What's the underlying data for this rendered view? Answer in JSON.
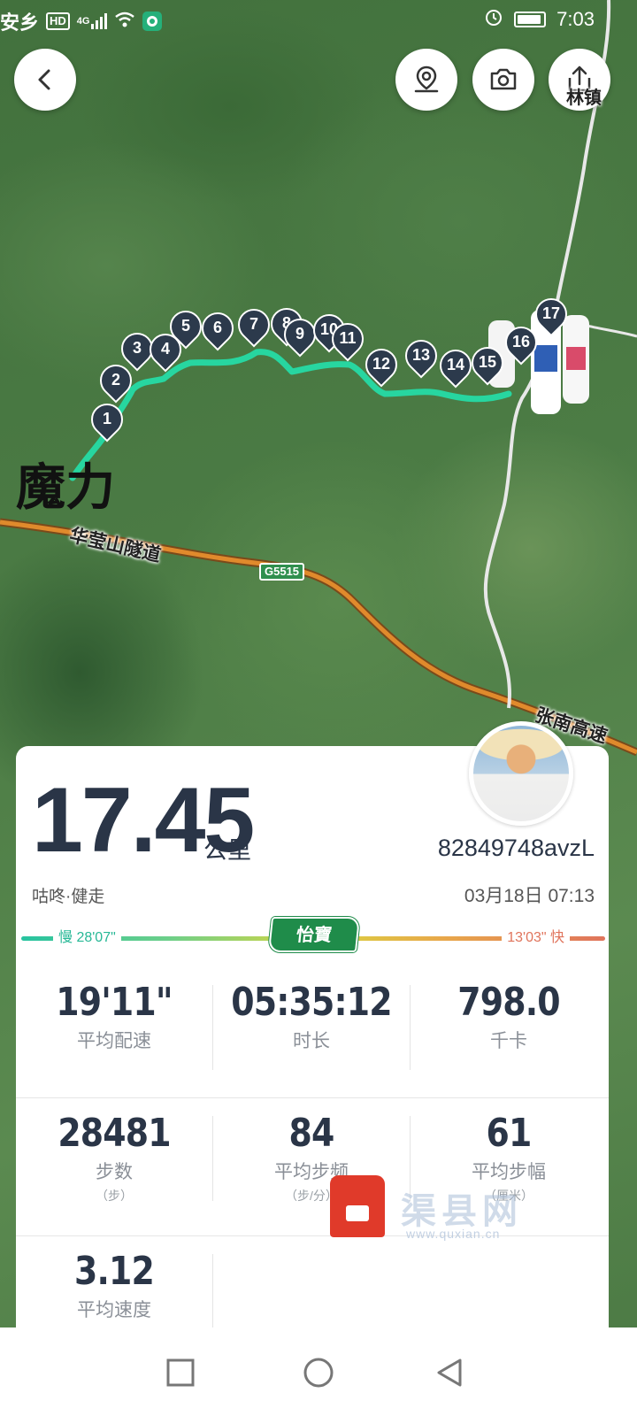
{
  "status_bar": {
    "location": "安乡",
    "network": "4G",
    "hd": "HD",
    "time": "7:03"
  },
  "map": {
    "place_label": "魔力",
    "tunnel_label": "华莹山隧道",
    "highway_code": "G5515",
    "highway_label": "张南高速",
    "corner_label": "林镇",
    "waypoints": [
      "1",
      "2",
      "3",
      "4",
      "5",
      "6",
      "7",
      "8",
      "9",
      "10",
      "11",
      "12",
      "13",
      "14",
      "15",
      "16",
      "17"
    ],
    "route_color": "#27d6a0"
  },
  "top_buttons": {
    "back": "back-icon",
    "location": "location-pin-icon",
    "camera": "camera-icon",
    "share": "share-icon"
  },
  "summary": {
    "distance": "17.45",
    "distance_unit": "公里",
    "username": "82849748avzL",
    "sport": "咕咚·健走",
    "datetime": "03月18日 07:13"
  },
  "pace": {
    "slow": "慢 28'07\"",
    "fast": "13'03\" 快",
    "sponsor": "怡寶"
  },
  "stats": {
    "avg_pace": {
      "value": "19'11\"",
      "label": "平均配速"
    },
    "duration": {
      "value": "05:35:12",
      "label": "时长"
    },
    "calories": {
      "value": "798.0",
      "label": "千卡"
    },
    "steps": {
      "value": "28481",
      "label": "步数",
      "unit": "（步）"
    },
    "cadence": {
      "value": "84",
      "label": "平均步频",
      "unit": "（步/分）"
    },
    "stride": {
      "value": "61",
      "label": "平均步幅",
      "unit": "（厘米）"
    },
    "avg_speed": {
      "value": "3.12",
      "label": "平均速度"
    }
  },
  "watermark": {
    "text": "渠县网",
    "url": "www.quxian.cn"
  },
  "colors": {
    "accent_dark": "#2a3547",
    "route": "#27d6a0",
    "pace_slow": "#27b896",
    "pace_fast": "#e0745c",
    "sponsor_green": "#1f8c4a"
  }
}
